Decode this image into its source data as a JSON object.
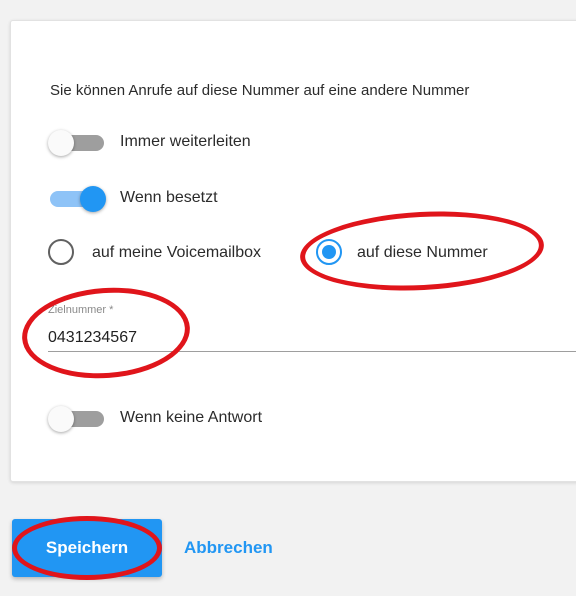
{
  "intro_text": "Sie können Anrufe auf diese Nummer auf eine andere Nummer",
  "toggles": {
    "always_forward": {
      "label": "Immer weiterleiten",
      "on": false
    },
    "when_busy": {
      "label": "Wenn besetzt",
      "on": true
    },
    "no_answer": {
      "label": "Wenn keine Antwort",
      "on": false
    }
  },
  "radios": {
    "voicemail": {
      "label": "auf meine Voicemailbox",
      "selected": false
    },
    "this_number": {
      "label": "auf diese Nummer",
      "selected": true
    }
  },
  "target_field": {
    "label": "Zielnummer *",
    "value": "0431234567"
  },
  "buttons": {
    "save_label": "Speichern",
    "cancel_label": "Abbrechen"
  },
  "colors": {
    "accent": "#2196f3",
    "annotation": "#e0151b"
  }
}
